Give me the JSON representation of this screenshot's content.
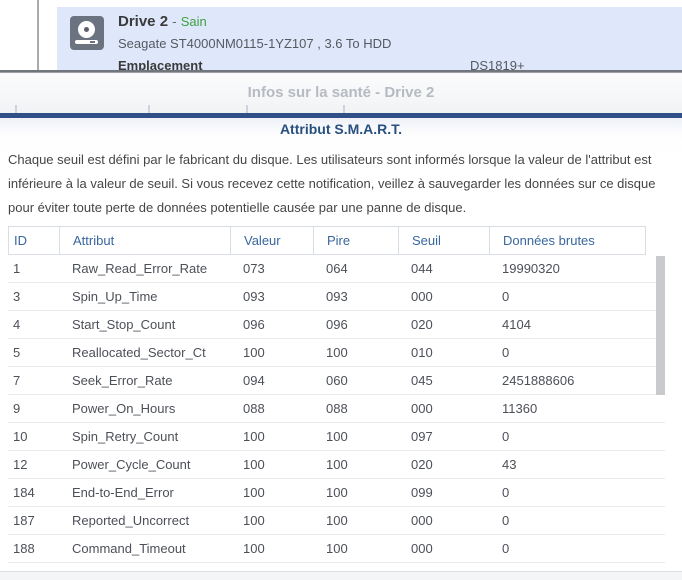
{
  "background": {
    "drive_name": "Drive 2",
    "separator": "-",
    "status": "Sain",
    "status_color": "#3ea03e",
    "model": "Seagate ST4000NM0115-1YZ107 , 3.6 To HDD",
    "location_label": "Emplacement",
    "location_value": "DS1819+",
    "panel_bg": "#dfe8fb"
  },
  "dialog": {
    "title": "Infos sur la santé - Drive 2",
    "section_title": "Attribut S.M.A.R.T.",
    "description": "Chaque seuil est défini par le fabricant du disque. Les utilisateurs sont informés lorsque la valeur de l'attribut est inférieure à la valeur de seuil. Si vous recevez cette notification, veillez à sauvegarder les données sur ce disque pour éviter toute perte de données potentielle causée par une panne de disque.",
    "accent_color": "#314f87"
  },
  "table": {
    "columns": [
      "ID",
      "Attribut",
      "Valeur",
      "Pire",
      "Seuil",
      "Données brutes"
    ],
    "rows": [
      {
        "id": "1",
        "attribute": "Raw_Read_Error_Rate",
        "value": "073",
        "worst": "064",
        "threshold": "044",
        "raw": "19990320"
      },
      {
        "id": "3",
        "attribute": "Spin_Up_Time",
        "value": "093",
        "worst": "093",
        "threshold": "000",
        "raw": "0"
      },
      {
        "id": "4",
        "attribute": "Start_Stop_Count",
        "value": "096",
        "worst": "096",
        "threshold": "020",
        "raw": "4104"
      },
      {
        "id": "5",
        "attribute": "Reallocated_Sector_Ct",
        "value": "100",
        "worst": "100",
        "threshold": "010",
        "raw": "0"
      },
      {
        "id": "7",
        "attribute": "Seek_Error_Rate",
        "value": "094",
        "worst": "060",
        "threshold": "045",
        "raw": "2451888606"
      },
      {
        "id": "9",
        "attribute": "Power_On_Hours",
        "value": "088",
        "worst": "088",
        "threshold": "000",
        "raw": "11360"
      },
      {
        "id": "10",
        "attribute": "Spin_Retry_Count",
        "value": "100",
        "worst": "100",
        "threshold": "097",
        "raw": "0"
      },
      {
        "id": "12",
        "attribute": "Power_Cycle_Count",
        "value": "100",
        "worst": "100",
        "threshold": "020",
        "raw": "43"
      },
      {
        "id": "184",
        "attribute": "End-to-End_Error",
        "value": "100",
        "worst": "100",
        "threshold": "099",
        "raw": "0"
      },
      {
        "id": "187",
        "attribute": "Reported_Uncorrect",
        "value": "100",
        "worst": "100",
        "threshold": "000",
        "raw": "0"
      },
      {
        "id": "188",
        "attribute": "Command_Timeout",
        "value": "100",
        "worst": "100",
        "threshold": "000",
        "raw": "0"
      }
    ]
  }
}
